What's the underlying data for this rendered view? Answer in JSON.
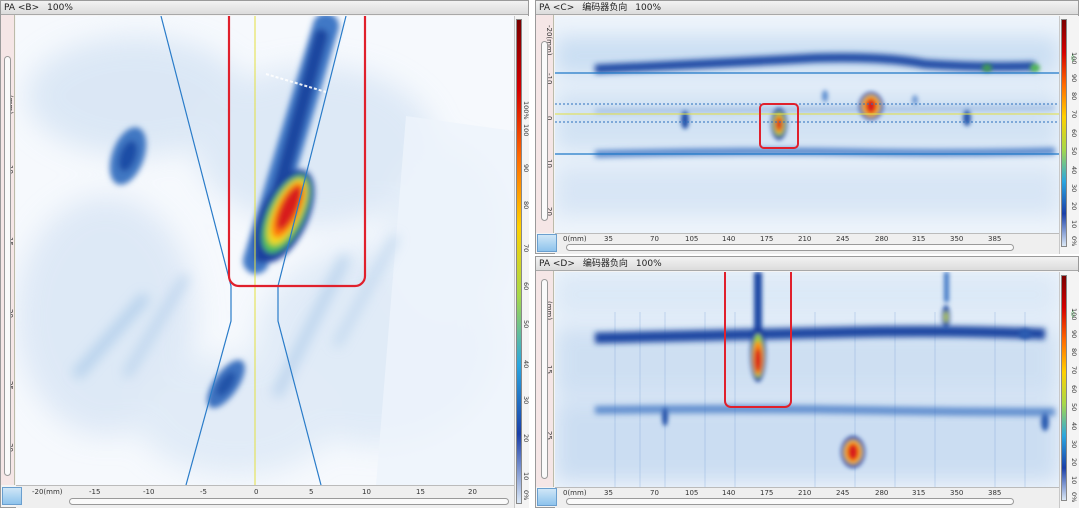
{
  "panels": {
    "b": {
      "title_prefix": "PA <B>",
      "zoom": "100%",
      "v_unit": "(mm)",
      "v_ticks": [
        "10",
        "15",
        "20",
        "25",
        "30"
      ],
      "h_ticks": [
        "-20(mm)",
        "-15",
        "-10",
        "-5",
        "0",
        "5",
        "10",
        "15",
        "20"
      ],
      "cb_labels": [
        "100%",
        "100",
        "90",
        "80",
        "70",
        "60",
        "50",
        "40",
        "30",
        "20",
        "10",
        "0%"
      ]
    },
    "c": {
      "title_prefix": "PA <C>",
      "title_axis": "编码器负向",
      "zoom": "100%",
      "v_ticks": [
        "-20(mm)",
        "-10",
        "0",
        "10",
        "20"
      ],
      "h_ticks": [
        "0(mm)",
        "35",
        "70",
        "105",
        "140",
        "175",
        "210",
        "245",
        "280",
        "315",
        "350",
        "385"
      ],
      "cb_labels": [
        "100",
        "90",
        "80",
        "70",
        "60",
        "50",
        "40",
        "30",
        "20",
        "10",
        "0%"
      ]
    },
    "d": {
      "title_prefix": "PA <D>",
      "title_axis": "编码器负向",
      "zoom": "100%",
      "v_ticks": [
        "(mm)",
        "15",
        "25"
      ],
      "h_ticks": [
        "0(mm)",
        "35",
        "70",
        "105",
        "140",
        "175",
        "210",
        "245",
        "280",
        "315",
        "350",
        "385"
      ],
      "cb_labels": [
        "100",
        "90",
        "80",
        "70",
        "60",
        "50",
        "40",
        "30",
        "20",
        "10",
        "0%"
      ]
    }
  },
  "colors": {
    "highlight_box": "#e0202c",
    "cursor_line": "#e4e040",
    "gate_line": "#1f78c8"
  }
}
